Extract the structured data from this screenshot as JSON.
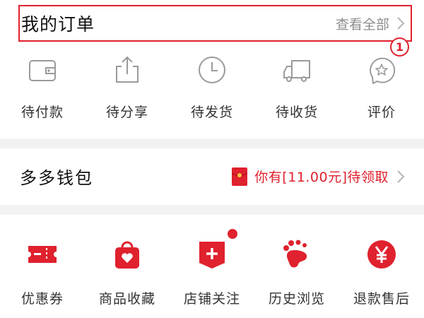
{
  "orders": {
    "title": "我的订单",
    "view_all": "查看全部",
    "marker": "1",
    "items": [
      {
        "label": "待付款",
        "icon": "wallet-icon"
      },
      {
        "label": "待分享",
        "icon": "share-icon"
      },
      {
        "label": "待发货",
        "icon": "clock-icon"
      },
      {
        "label": "待收货",
        "icon": "truck-icon"
      },
      {
        "label": "评价",
        "icon": "review-star-icon"
      }
    ]
  },
  "wallet": {
    "title": "多多钱包",
    "notice": "你有[11.00元]待领取",
    "icon": "red-envelope-icon"
  },
  "services": {
    "items": [
      {
        "label": "优惠券",
        "icon": "coupon-icon"
      },
      {
        "label": "商品收藏",
        "icon": "favorite-bag-icon"
      },
      {
        "label": "店铺关注",
        "icon": "store-follow-icon"
      },
      {
        "label": "历史浏览",
        "icon": "footprint-icon"
      },
      {
        "label": "退款售后",
        "icon": "refund-yen-icon"
      }
    ]
  },
  "colors": {
    "accent": "#e0212e",
    "icon_gray": "#9a9a9a",
    "separator": "#f2f2f2"
  }
}
